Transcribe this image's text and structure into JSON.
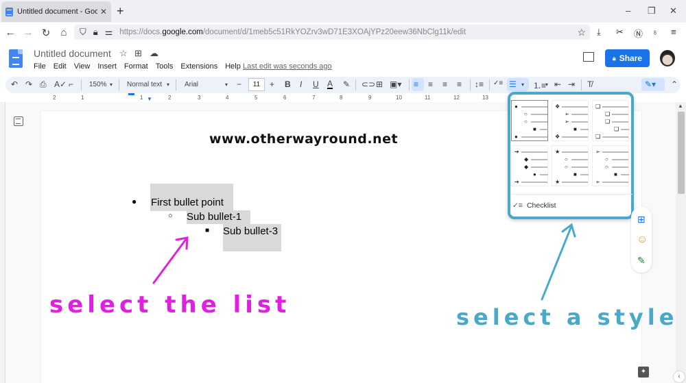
{
  "browser": {
    "tab_title": "Untitled document - Google Do",
    "new_tab": "+",
    "window_controls": {
      "minimize": "–",
      "restore": "❐",
      "close": "✕"
    },
    "url_prefix": "https://docs.",
    "url_domain": "google.com",
    "url_path": "/document/d/1meb5c51RkYOZrv3wD71E3XOAjYPz20eew36NbClg11k/edit",
    "nav_icons": [
      "back-icon",
      "forward-icon",
      "reload-icon",
      "home-icon"
    ],
    "toolbar_icons": [
      "download-icon",
      "screenshot-icon",
      "notion-icon",
      "extension-icon",
      "menu-icon"
    ]
  },
  "docs": {
    "title": "Untitled document",
    "menu": [
      "File",
      "Edit",
      "View",
      "Insert",
      "Format",
      "Tools",
      "Extensions",
      "Help"
    ],
    "last_edit": "Last edit was seconds ago",
    "share_label": "Share"
  },
  "toolbar": {
    "zoom": "150%",
    "style": "Normal text",
    "font": "Arial",
    "font_size": "11",
    "minus": "−",
    "plus": "+"
  },
  "ruler": {
    "ticks": [
      "2",
      "1",
      "1",
      "2",
      "3",
      "4",
      "5",
      "6",
      "7",
      "8",
      "9",
      "10",
      "11",
      "12",
      "13"
    ]
  },
  "document": {
    "website": "www.otherwayround.net",
    "bullets": [
      {
        "symbol": "●",
        "text": "First bullet point",
        "level": 1
      },
      {
        "symbol": "○",
        "text": "Sub bullet-1",
        "level": 2
      },
      {
        "symbol": "■",
        "text": "Sub bullet-3",
        "level": 3
      }
    ]
  },
  "bullet_menu": {
    "presets": [
      {
        "symbols": [
          "●",
          "○",
          "○",
          "■",
          "●"
        ],
        "selected": true
      },
      {
        "symbols": [
          "❖",
          "➢",
          "➢",
          "■",
          "❖"
        ],
        "selected": false
      },
      {
        "symbols": [
          "❑",
          "❑",
          "❑",
          "❑",
          "❑"
        ],
        "selected": false
      },
      {
        "symbols": [
          "➔",
          "◆",
          "◆",
          "●",
          "➔"
        ],
        "selected": false
      },
      {
        "symbols": [
          "★",
          "○",
          "○",
          "■",
          "★"
        ],
        "selected": false
      },
      {
        "symbols": [
          "➢",
          "○",
          "○",
          "■",
          "➢"
        ],
        "selected": false
      }
    ],
    "checklist_label": "Checklist"
  },
  "annotations": {
    "left": "select the list",
    "right": "select a style",
    "left_color": "#e020e0",
    "right_color": "#4aa8c9"
  },
  "colors": {
    "share": "#1a73e8",
    "toolbar_bg": "#edf2fa",
    "highlight": "#d9d9d9"
  }
}
